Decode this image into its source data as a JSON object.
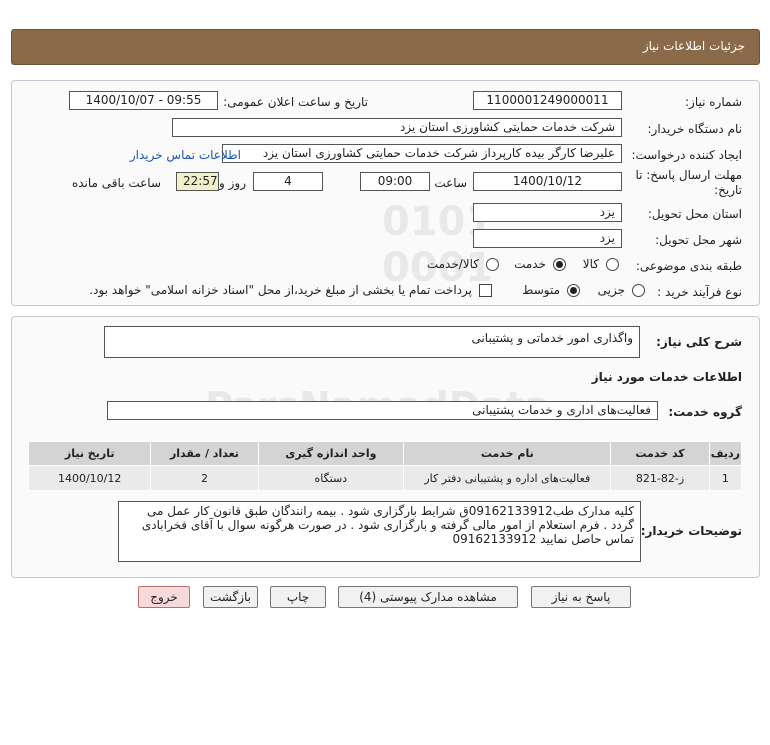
{
  "header": {
    "title": "جزئیات اطلاعات نیاز"
  },
  "details": {
    "need_number_label": "شماره نیاز:",
    "need_number": "1100001249000011",
    "announce_label": "تاریخ و ساعت اعلان عمومی:",
    "announce_value": "1400/10/07 - 09:55",
    "buyer_org_label": "نام دستگاه خریدار:",
    "buyer_org": "شرکت خدمات حمایتی کشاورزی استان یزد",
    "creator_label": "ایجاد کننده درخواست:",
    "creator": "علیرضا کارگر بیده کارپرداز شرکت خدمات حمایتی کشاورزی استان یزد",
    "contact_link": "اطلاعات تماس خریدار",
    "deadline_label_1": "مهلت ارسال پاسخ: تا",
    "deadline_label_2": "تاریخ:",
    "deadline_date": "1400/10/12",
    "time_label": "ساعت",
    "deadline_time": "09:00",
    "days_value": "4",
    "days_label": "روز و",
    "remaining_time": "22:57:23",
    "remaining_label": "ساعت باقی مانده",
    "province_label": "استان محل تحویل:",
    "province": "یزد",
    "city_label": "شهر محل تحویل:",
    "city": "یزد",
    "category_label": "طبقه بندی موضوعی:",
    "category_options": [
      "کالا",
      "خدمت",
      "کالا/خدمت"
    ],
    "category_selected": "خدمت",
    "process_label": "نوع فرآیند خرید :",
    "process_options": [
      "جزیی",
      "متوسط"
    ],
    "process_selected": "متوسط",
    "payment_note": "پرداخت تمام یا بخشی از مبلغ خرید،از محل \"اسناد خزانه اسلامی\" خواهد بود."
  },
  "summary": {
    "general_desc_label": "شرح کلی نیاز:",
    "general_desc": "واگذاری امور خدماتی و پشتیبانی",
    "services_info_title": "اطلاعات خدمات مورد نیاز",
    "service_group_label": "گروه خدمت:",
    "service_group": "فعالیت‌های اداری و خدمات پشتیبانی",
    "table": {
      "headers": [
        "ردیف",
        "کد خدمت",
        "نام خدمت",
        "واحد اندازه گیری",
        "تعداد / مقدار",
        "تاریخ نیاز"
      ],
      "rows": [
        [
          "1",
          "ز-82-821",
          "فعالیت‌های اداره و پشتیبانی دفتر کار",
          "دستگاه",
          "2",
          "1400/10/12"
        ]
      ]
    },
    "buyer_notes_label": "توضیحات خریدار:",
    "buyer_notes": "کلیه مدارک طب09162133912ق شرایط بارگزاری شود . بیمه رانندگان طبق قانون کار عمل می گردد . فرم استعلام از امور مالی گرفته و بارگزاری شود . در صورت هرگونه سوال  با آقای فخرابادی تماس حاصل نمایید 09162133912"
  },
  "buttons": {
    "reply": "پاسخ به نیاز",
    "view_docs": "مشاهده مدارک پیوستی (4)",
    "print": "چاپ",
    "back": "بازگشت",
    "exit": "خروج"
  },
  "colors": {
    "header_bg": "#8b6a4a",
    "link": "#1a55b0",
    "exit_bg": "#f8d9d9"
  }
}
